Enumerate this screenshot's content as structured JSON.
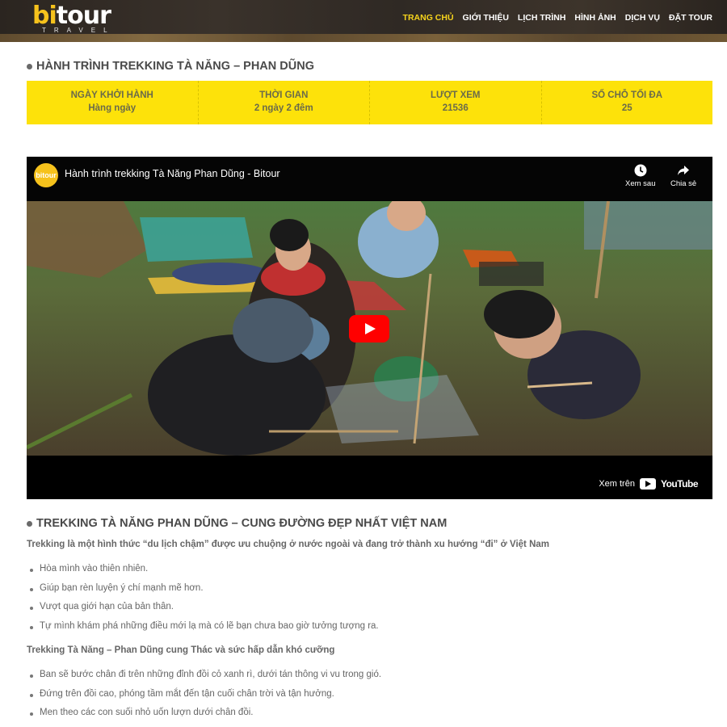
{
  "header": {
    "logo_main": "bi",
    "logo_main_2": "tour",
    "logo_sub": "TRAVEL",
    "nav": [
      {
        "label": "TRANG CHỦ",
        "active": true
      },
      {
        "label": "GIỚI THIỆU",
        "active": false
      },
      {
        "label": "LỊCH TRÌNH",
        "active": false
      },
      {
        "label": "HÌNH ẢNH",
        "active": false
      },
      {
        "label": "DỊCH VỤ",
        "active": false
      },
      {
        "label": "ĐẶT TOUR",
        "active": false
      }
    ]
  },
  "page_title": "HÀNH TRÌNH TREKKING TÀ NĂNG – PHAN DŨNG",
  "info": [
    {
      "label": "NGÀY KHỞI HÀNH",
      "value": "Hàng ngày"
    },
    {
      "label": "THỜI GIAN",
      "value": "2 ngày 2 đêm"
    },
    {
      "label": "LƯỢT XEM",
      "value": "21536"
    },
    {
      "label": "SỐ CHỖ TỐI ĐA",
      "value": "25"
    }
  ],
  "video": {
    "channel_icon": "bitour",
    "title": "Hành trình trekking Tà Năng Phan Dũng - Bitour",
    "watch_later": "Xem sau",
    "share": "Chia sẻ",
    "watch_on": "Xem trên",
    "youtube": "YouTube"
  },
  "section": {
    "title": "TREKKING TÀ NĂNG PHAN DŨNG – CUNG ĐƯỜNG ĐẸP NHẤT VIỆT NAM",
    "intro": "Trekking là một hình thức “du lịch chậm” được ưu chuộng ở nước ngoài và đang trở thành xu hướng “đi” ở Việt Nam",
    "list1": [
      "Hòa mình vào thiên nhiên.",
      "Giúp bạn rèn luyện ý chí mạnh mẽ hơn.",
      "Vượt qua giới hạn của bản thân.",
      "Tự mình khám phá những điều mới lạ mà có lẽ bạn chưa bao giờ tưởng tượng ra."
    ],
    "subhead": "Trekking Tà Năng – Phan Dũng cung Thác và sức hấp dẫn khó cưỡng",
    "list2": [
      "Ban sẽ bước chân đi trên những đỉnh đồi cỏ xanh rì, dưới tán thông vi vu trong gió.",
      "Đứng trên đồi cao, phóng tầm mắt đến tận cuối chân trời và tận hưởng.",
      "Men theo các con suối nhỏ uốn lượn dưới chân đồi."
    ]
  },
  "colors": {
    "accent": "#fde20a",
    "brand": "#f6c21c",
    "play": "#ff0000"
  }
}
